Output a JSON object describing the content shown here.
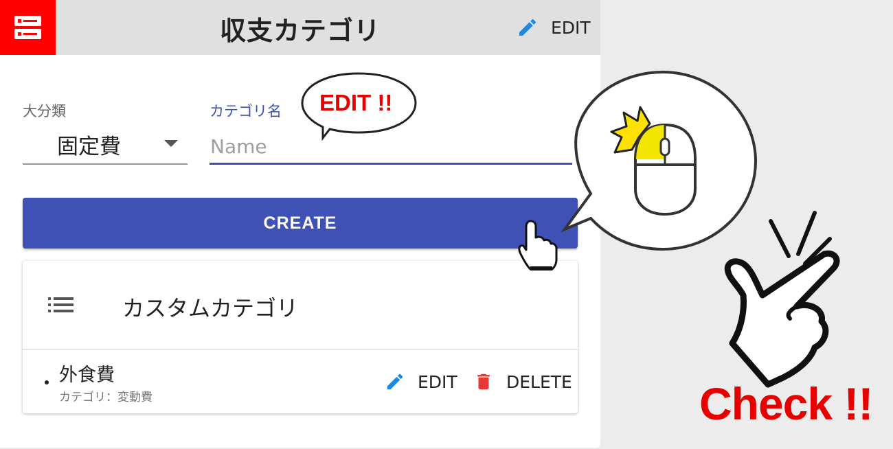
{
  "app_bar": {
    "title": "収支カテゴリ",
    "menu_icon": "storage-icon",
    "edit_icon": "pencil-icon",
    "edit_label": "EDIT",
    "accent": "#ff0000"
  },
  "form": {
    "major_class_label": "大分類",
    "major_class_value": "固定費",
    "category_name_label": "カテゴリ名",
    "category_name_placeholder": "Name",
    "create_label": "CREATE",
    "primary_color": "#3f51b5"
  },
  "custom_categories": {
    "title": "カスタムカテゴリ",
    "icon": "list-icon",
    "items": [
      {
        "name": "外食費",
        "subtitle": "カテゴリ：変動費",
        "edit_label": "EDIT",
        "delete_label": "DELETE",
        "delete_icon": "trash-icon"
      }
    ]
  },
  "annotations": {
    "edit_callout": "EDIT !!",
    "check": "Check !!",
    "highlight_color": "#e60000"
  }
}
